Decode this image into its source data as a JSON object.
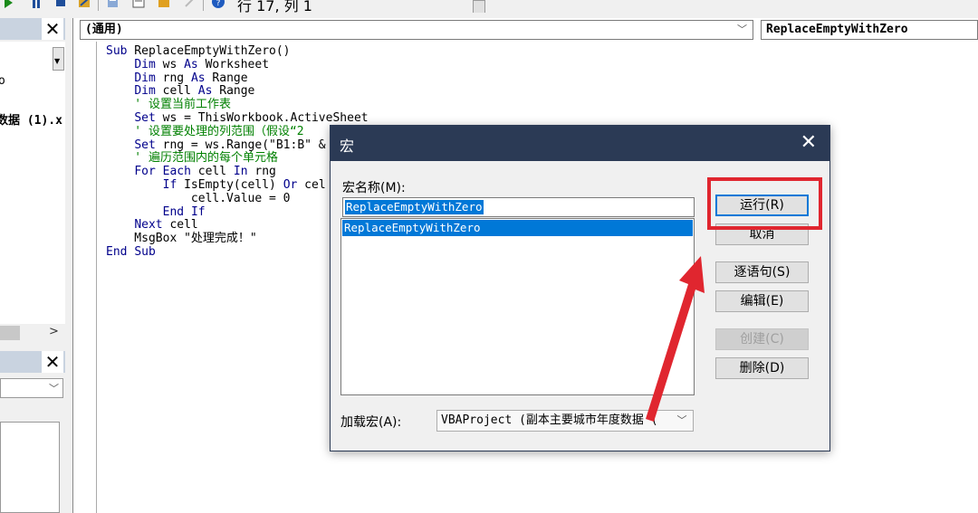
{
  "toolbar": {
    "status": "行 17, 列 1",
    "icons": [
      "run-icon",
      "pause-icon",
      "stop-icon",
      "design-mode-icon",
      "project-explorer-icon",
      "properties-icon",
      "toolbox-icon",
      "help-icon"
    ]
  },
  "left_panel": {
    "top_fragment": "o",
    "file_fragment": "数据 (1).x",
    "scroll_right": ">",
    "close_label": "✕"
  },
  "code_window": {
    "object_combo": "(通用)",
    "proc_combo": "ReplaceEmptyWithZero",
    "lines": [
      "Sub ReplaceEmptyWithZero()",
      "    Dim ws As Worksheet",
      "    Dim rng As Range",
      "    Dim cell As Range",
      "    ' 设置当前工作表",
      "    Set ws = ThisWorkbook.ActiveSheet",
      "    ' 设置要处理的列范围（假设“2",
      "    Set rng = ws.Range(\"B1:B\" &",
      "    ' 遍历范围内的每个单元格",
      "    For Each cell In rng",
      "        If IsEmpty(cell) Or cel",
      "            cell.Value = 0",
      "        End If",
      "    Next cell",
      "    MsgBox \"处理完成！\"",
      "End Sub"
    ]
  },
  "dialog": {
    "title": "宏",
    "close_label": "✕",
    "macro_name_label": "宏名称(M):",
    "macro_name_value": "ReplaceEmptyWithZero",
    "macro_list": [
      "ReplaceEmptyWithZero"
    ],
    "buttons": {
      "run": "运行(R)",
      "cancel": "取消",
      "step_into": "逐语句(S)",
      "edit": "编辑(E)",
      "create": "创建(C)",
      "delete": "删除(D)"
    },
    "macros_in_label": "加载宏(A):",
    "macros_in_value": "VBAProject (副本主要城市年度数据 ("
  },
  "colors": {
    "title_bar": "#2b3a55",
    "selection": "#0078d7",
    "annotation": "#e0262f",
    "keyword": "#00008b",
    "comment": "#008000"
  }
}
